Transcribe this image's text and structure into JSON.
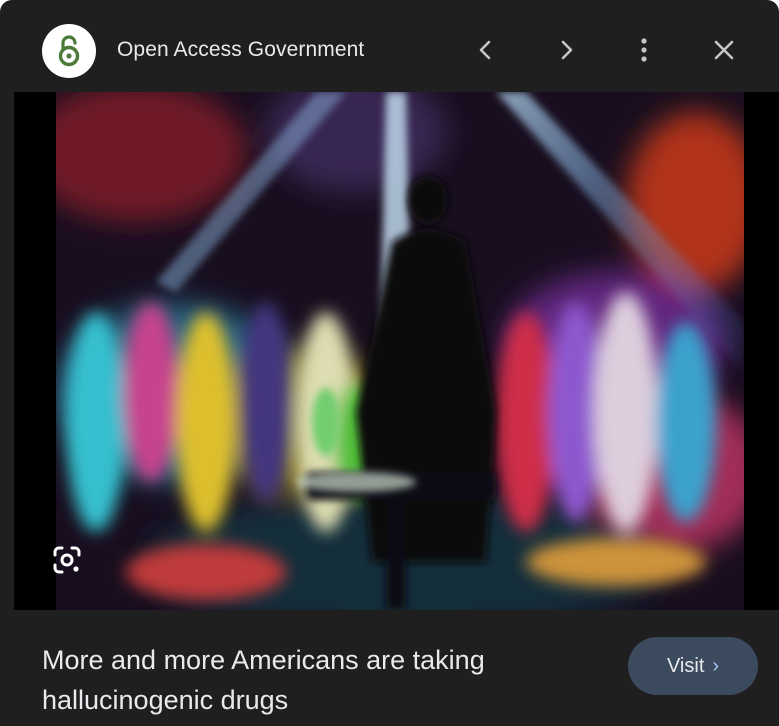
{
  "header": {
    "site_name": "Open Access Government",
    "logo_icon": "open-access-lock-icon",
    "prev_icon": "chevron-left-icon",
    "next_icon": "chevron-right-icon",
    "more_icon": "more-vert-icon",
    "close_icon": "close-icon"
  },
  "image": {
    "lens_icon": "google-lens-icon"
  },
  "footer": {
    "caption": "More and more Americans are taking hallucinogenic drugs",
    "visit_label": "Visit",
    "visit_chevron": "›"
  },
  "colors": {
    "panel_bg": "#1f1f1f",
    "text": "#e8eaed",
    "visit_bg": "#3c4a5e",
    "accent": "#a8c7fa"
  }
}
